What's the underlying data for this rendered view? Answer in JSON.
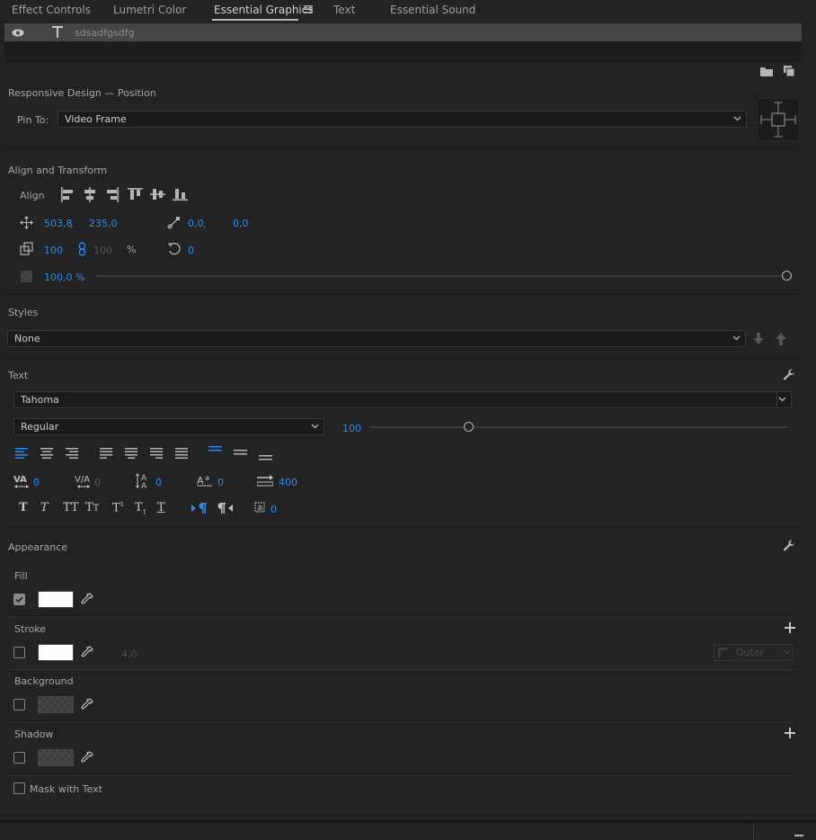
{
  "tabs": [
    {
      "label": "Effect Controls"
    },
    {
      "label": "Lumetri Color"
    },
    {
      "label": "Essential Graphics"
    },
    {
      "label": "Text"
    },
    {
      "label": "Essential Sound"
    }
  ],
  "layer": {
    "name": "sdsadfgsdfg"
  },
  "responsive": {
    "title": "Responsive Design — Position",
    "pin_label": "Pin To:",
    "pin_value": "Video Frame"
  },
  "align": {
    "title": "Align and Transform",
    "align_label": "Align",
    "position_x": "503,8",
    "position_sep": ",",
    "position_y": "235,0",
    "anchor_x": "0,0",
    "anchor_sep": ",",
    "anchor_y": "0,0",
    "scale": "100",
    "scale_height": "100",
    "scale_unit": "%",
    "rotation": "0",
    "opacity": "100,0 %",
    "opacity_level": 1.0
  },
  "styles": {
    "title": "Styles",
    "value": "None"
  },
  "text": {
    "title": "Text",
    "font": "Tahoma",
    "font_style": "Regular",
    "font_size": "100",
    "font_size_level": 0.24,
    "kerning": "0",
    "tracking": "0",
    "leading": "0",
    "baseline": "0",
    "tab_width": "400",
    "tsume": "0"
  },
  "appearance": {
    "title": "Appearance",
    "fill_label": "Fill",
    "fill_checked": true,
    "fill_color": "#ffffff",
    "stroke_label": "Stroke",
    "stroke_width": "4,0",
    "stroke_color": "#ffffff",
    "stroke_position": "Outer",
    "background_label": "Background",
    "shadow_label": "Shadow",
    "mask_label": "Mask with Text"
  },
  "colors": {
    "accent": "#2d8ceb",
    "panel": "#232323",
    "layer_row": "#464646"
  }
}
